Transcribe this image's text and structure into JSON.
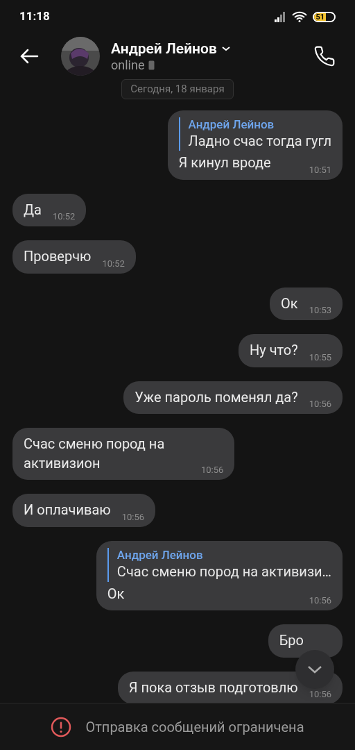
{
  "status_bar": {
    "time": "11:18",
    "battery": "51"
  },
  "header": {
    "name": "Андрей Лейнов",
    "status": "online"
  },
  "date_chip": "Сегодня, 18 января",
  "messages": [
    {
      "kind": "outgoing",
      "reply": {
        "author": "Андрей Лейнов",
        "text": "Ладно счас тогда гугл"
      },
      "text": "Я кинул вроде",
      "time": "10:51"
    },
    {
      "kind": "incoming",
      "text": "Да",
      "time": "10:52"
    },
    {
      "kind": "incoming",
      "text": "Проверчю",
      "time": "10:52"
    },
    {
      "kind": "outgoing",
      "text": "Ок",
      "time": "10:53"
    },
    {
      "kind": "outgoing",
      "text": "Ну что?",
      "time": "10:55"
    },
    {
      "kind": "outgoing",
      "text": "Уже пароль поменял да?",
      "time": "10:56"
    },
    {
      "kind": "incoming",
      "text": "Счас сменю пород на активизион",
      "time": "10:56"
    },
    {
      "kind": "incoming",
      "text": "И оплачиваю",
      "time": "10:56"
    },
    {
      "kind": "outgoing",
      "reply": {
        "author": "Андрей Лейнов",
        "text": "Счас сменю пород на активизи…"
      },
      "text": "Ок",
      "time": "10:56"
    },
    {
      "kind": "outgoing",
      "text": "Бро"
    },
    {
      "kind": "outgoing",
      "text": "Я пока отзыв подготовлю",
      "time": "10:56"
    }
  ],
  "footer": {
    "notice": "Отправка сообщений ограничена"
  }
}
